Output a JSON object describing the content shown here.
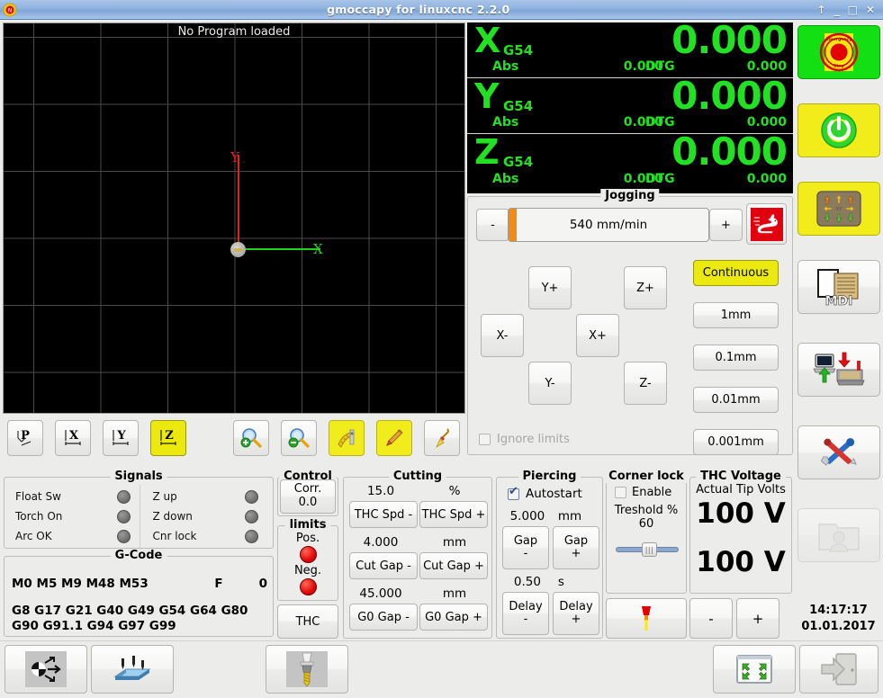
{
  "window": {
    "title": "gmoccapy for linuxcnc 2.2.0",
    "app_icon": "linuxcnc-icon",
    "buttons": {
      "shade": "↑",
      "minimize": "_",
      "maximize": "□",
      "close": "✕"
    }
  },
  "graphics": {
    "status_text": "No Program loaded",
    "axis_y_label": "Y",
    "axis_x_label": "X",
    "bg_color": "#000000",
    "grid_color": "#4a4a4a",
    "x_axis_color": "#1fd11f",
    "y_axis_color": "#e02020"
  },
  "dro": {
    "rows": [
      {
        "axis": "X",
        "coordinate_system": "G54",
        "position": "0.000",
        "abs_label": "Abs",
        "abs_value": "0.000",
        "dtg_label": "DTG",
        "dtg_value": "0.000"
      },
      {
        "axis": "Y",
        "coordinate_system": "G54",
        "position": "0.000",
        "abs_label": "Abs",
        "abs_value": "0.000",
        "dtg_label": "DTG",
        "dtg_value": "0.000"
      },
      {
        "axis": "Z",
        "coordinate_system": "G54",
        "position": "0.000",
        "abs_label": "Abs",
        "abs_value": "0.000",
        "dtg_label": "DTG",
        "dtg_value": "0.000"
      }
    ],
    "text_color": "#22e022"
  },
  "jogging": {
    "legend": "Jogging",
    "speed_minus": "-",
    "speed_plus": "+",
    "speed_value": "540 mm/min",
    "rabbit_icon": "rabbit-icon",
    "jog_buttons": [
      {
        "id": "y-plus",
        "label": "Y+"
      },
      {
        "id": "z-plus",
        "label": "Z+"
      },
      {
        "id": "x-minus",
        "label": "X-"
      },
      {
        "id": "x-plus",
        "label": "X+"
      },
      {
        "id": "y-minus",
        "label": "Y-"
      },
      {
        "id": "z-minus",
        "label": "Z-"
      }
    ],
    "increments": [
      {
        "label": "Continuous",
        "selected": true
      },
      {
        "label": "1mm",
        "selected": false
      },
      {
        "label": "0.1mm",
        "selected": false
      },
      {
        "label": "0.01mm",
        "selected": false
      },
      {
        "label": "0.001mm",
        "selected": false
      }
    ],
    "ignore_limits_label": "Ignore limits",
    "ignore_limits_checked": false
  },
  "toolstrip": {
    "buttons": [
      {
        "id": "touch-off-p",
        "label": "P",
        "icon": "touch-off-p-icon",
        "active": false
      },
      {
        "id": "touch-off-x",
        "label": "X",
        "icon": "touch-off-x-icon",
        "active": false
      },
      {
        "id": "touch-off-y",
        "label": "Y",
        "icon": "touch-off-y-icon",
        "active": false
      },
      {
        "id": "touch-off-z",
        "label": "Z",
        "icon": "touch-off-z-icon",
        "active": true
      },
      {
        "id": "zoom-in",
        "label": "",
        "icon": "zoom-in-icon",
        "active": false
      },
      {
        "id": "zoom-out",
        "label": "",
        "icon": "zoom-out-icon",
        "active": false
      },
      {
        "id": "dimensions",
        "label": "",
        "icon": "measure-icon",
        "active": true
      },
      {
        "id": "edit",
        "label": "",
        "icon": "pencil-icon",
        "active": true
      },
      {
        "id": "clear",
        "label": "",
        "icon": "broom-icon",
        "active": false
      }
    ]
  },
  "signals": {
    "legend": "Signals",
    "left": [
      {
        "label": "Float Sw",
        "state": "off"
      },
      {
        "label": "Torch On",
        "state": "off"
      },
      {
        "label": "Arc OK",
        "state": "off"
      }
    ],
    "right": [
      {
        "label": "Z up",
        "state": "off"
      },
      {
        "label": "Z down",
        "state": "off"
      },
      {
        "label": "Cnr lock",
        "state": "off"
      }
    ]
  },
  "gcode": {
    "legend": "G-Code",
    "modal_m": "M0 M5 M9 M48 M53",
    "feed_label": "F",
    "feed_value": "0",
    "modal_g_line1": "G8 G17 G21 G40 G49 G54 G64 G80",
    "modal_g_line2": " G90 G91.1 G94 G97 G99"
  },
  "control": {
    "legend": "Control",
    "corr_label": "Corr.",
    "corr_value": "0.0"
  },
  "limits": {
    "legend": "limits",
    "pos_label": "Pos.",
    "pos_state": "on",
    "neg_label": "Neg.",
    "neg_state": "on",
    "thc_button": "THC",
    "led_on_color": "#e40a0a"
  },
  "cutting": {
    "legend": "Cutting",
    "thc_speed_value": "15.0",
    "thc_speed_unit": "%",
    "thc_minus": "THC Spd -",
    "thc_plus": "THC Spd +",
    "cut_gap_value": "4.000",
    "cut_gap_unit": "mm",
    "cut_gap_minus": "Cut Gap -",
    "cut_gap_plus": "Cut Gap +",
    "g0_gap_value": "45.000",
    "g0_gap_unit": "mm",
    "g0_gap_minus": "G0 Gap -",
    "g0_gap_plus": "G0 Gap +"
  },
  "piercing": {
    "legend": "Piercing",
    "autostart_label": "Autostart",
    "autostart_checked": true,
    "gap_value": "5.000",
    "gap_unit": "mm",
    "gap_minus": "Gap\n-",
    "gap_minus_l1": "Gap",
    "gap_minus_l2": "-",
    "gap_plus_l1": "Gap",
    "gap_plus_l2": "+",
    "delay_value": "0.50",
    "delay_unit": "s",
    "delay_minus_l1": "Delay",
    "delay_minus_l2": "-",
    "delay_plus_l1": "Delay",
    "delay_plus_l2": "+"
  },
  "corner_lock": {
    "legend": "Corner lock",
    "enable_label": "Enable",
    "enable_checked": false,
    "threshold_label": "Treshold %",
    "threshold_value": "60",
    "torch_icon": "torch-flame-icon"
  },
  "thc_voltage": {
    "legend": "THC Voltage",
    "caption": "Actual Tip Volts",
    "actual_value": "100 V",
    "target_value": "100 V",
    "minus": "-",
    "plus": "+"
  },
  "sidebar": {
    "buttons": [
      {
        "id": "estop",
        "icon": "emergency-stop-icon",
        "label": ""
      },
      {
        "id": "machine-power",
        "icon": "power-icon",
        "label": ""
      },
      {
        "id": "manual-mode",
        "icon": "jog-keypad-icon",
        "label": ""
      },
      {
        "id": "mdi-mode",
        "icon": "mdi-icon",
        "label": "MDI"
      },
      {
        "id": "auto-mode",
        "icon": "load-program-icon",
        "label": ""
      },
      {
        "id": "settings",
        "icon": "tools-icon",
        "label": ""
      },
      {
        "id": "user-tabs",
        "icon": "user-folder-icon",
        "label": ""
      }
    ],
    "clock_time": "14:17:17",
    "clock_date": "01.01.2017"
  },
  "bottombar": {
    "buttons": [
      {
        "id": "homing",
        "icon": "homing-icon"
      },
      {
        "id": "touch-off",
        "icon": "touch-off-icon"
      },
      {
        "id": "tool",
        "icon": "tool-icon"
      },
      {
        "id": "fullscreen",
        "icon": "fullscreen-icon"
      },
      {
        "id": "exit",
        "icon": "exit-icon"
      }
    ]
  }
}
